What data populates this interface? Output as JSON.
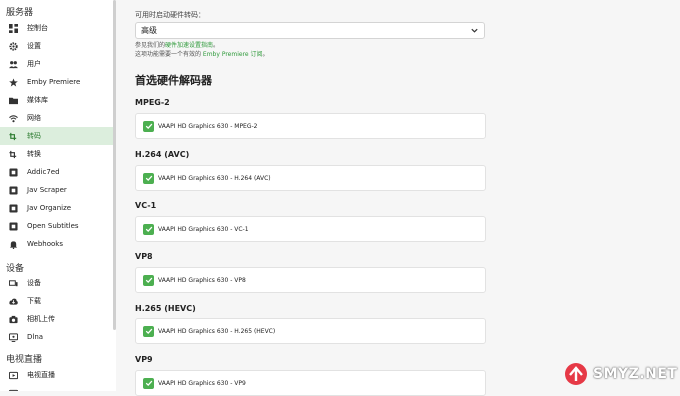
{
  "sidebar": {
    "sections": [
      {
        "title": "服务器"
      },
      {
        "title": "设备"
      },
      {
        "title": "电视直播"
      }
    ],
    "items": [
      {
        "label": "控制台",
        "icon": "dashboard-icon"
      },
      {
        "label": "设置",
        "icon": "gear-icon"
      },
      {
        "label": "用户",
        "icon": "users-icon"
      },
      {
        "label": "Emby Premiere",
        "icon": "star-icon"
      },
      {
        "label": "媒体库",
        "icon": "folder-icon"
      },
      {
        "label": "网络",
        "icon": "wifi-icon"
      },
      {
        "label": "转码",
        "icon": "transcode-icon",
        "active": true
      },
      {
        "label": "转换",
        "icon": "convert-icon"
      },
      {
        "label": "Addic7ed",
        "icon": "puzzle-icon"
      },
      {
        "label": "Jav Scraper",
        "icon": "puzzle-icon"
      },
      {
        "label": "Jav Organize",
        "icon": "puzzle-icon"
      },
      {
        "label": "Open Subtitles",
        "icon": "puzzle-icon"
      },
      {
        "label": "Webhooks",
        "icon": "bell-icon"
      },
      {
        "label": "设备",
        "icon": "devices-icon"
      },
      {
        "label": "下载",
        "icon": "download-icon"
      },
      {
        "label": "相机上传",
        "icon": "camera-icon"
      },
      {
        "label": "Dlna",
        "icon": "dlna-icon"
      },
      {
        "label": "电视直播",
        "icon": "tv-icon"
      }
    ]
  },
  "main": {
    "hw_encoding_label": "可用时启动硬件转码：",
    "hw_encoding_value": "高级",
    "help_line1_prefix": "参见我们的",
    "help_line1_link": "硬件加速设置指南",
    "help_line1_suffix": "。",
    "help_line2_prefix": "这项功能需要一个有效的 ",
    "help_line2_link": "Emby Premiere 订阅",
    "help_line2_suffix": "。",
    "heading": "首选硬件解码器",
    "codecs": [
      {
        "title": "MPEG-2",
        "decoder": "VAAPI HD Graphics 630 - MPEG-2",
        "checked": true
      },
      {
        "title": "H.264 (AVC)",
        "decoder": "VAAPI HD Graphics 630 - H.264 (AVC)",
        "checked": true
      },
      {
        "title": "VC-1",
        "decoder": "VAAPI HD Graphics 630 - VC-1",
        "checked": true
      },
      {
        "title": "VP8",
        "decoder": "VAAPI HD Graphics 630 - VP8",
        "checked": true
      },
      {
        "title": "H.265 (HEVC)",
        "decoder": "VAAPI HD Graphics 630 - H.265 (HEVC)",
        "checked": true
      },
      {
        "title": "VP9",
        "decoder": "VAAPI HD Graphics 630 - VP9",
        "checked": true
      }
    ]
  },
  "watermark": {
    "text": "SMYZ.NET"
  },
  "colors": {
    "accent": "#4caf50",
    "active_bg": "#dceedd",
    "link": "#2e9a3a"
  }
}
